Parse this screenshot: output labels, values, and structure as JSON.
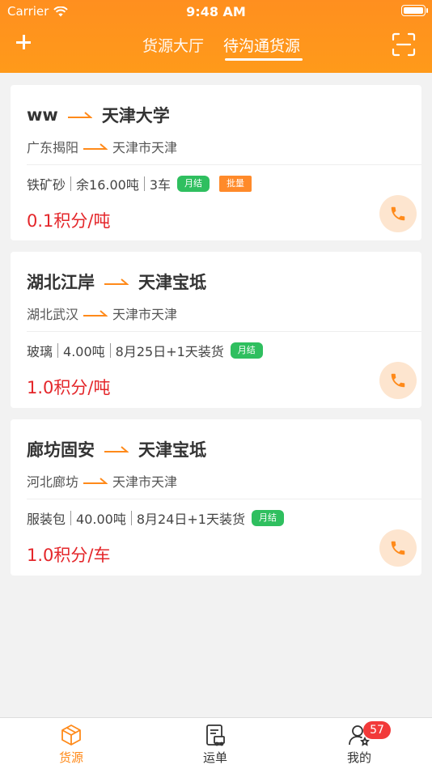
{
  "status_bar": {
    "carrier": "Carrier",
    "time": "9:48 AM"
  },
  "nav": {
    "tabs": [
      {
        "label": "货源大厅",
        "active": false
      },
      {
        "label": "待沟通货源",
        "active": true
      }
    ]
  },
  "cards": [
    {
      "from": "ww",
      "to": "天津大学",
      "sub_from": "广东揭阳",
      "sub_to": "天津市天津",
      "cargo": "铁矿砂",
      "amount": "余16.00吨",
      "extra": "3车",
      "tags": [
        "月结",
        "批量"
      ],
      "price": "0.1积分/吨"
    },
    {
      "from": "湖北江岸",
      "to": "天津宝坻",
      "sub_from": "湖北武汉",
      "sub_to": "天津市天津",
      "cargo": "玻璃",
      "amount": "4.00吨",
      "extra": "8月25日+1天装货",
      "tags": [
        "月结"
      ],
      "price": "1.0积分/吨"
    },
    {
      "from": "廊坊固安",
      "to": "天津宝坻",
      "sub_from": "河北廊坊",
      "sub_to": "天津市天津",
      "cargo": "服装包",
      "amount": "40.00吨",
      "extra": "8月24日+1天装货",
      "tags": [
        "月结"
      ],
      "price": "1.0积分/车"
    }
  ],
  "tabbar": {
    "items": [
      {
        "label": "货源",
        "icon": "box-icon",
        "active": true
      },
      {
        "label": "运单",
        "icon": "waybill-icon",
        "active": false
      },
      {
        "label": "我的",
        "icon": "user-icon",
        "active": false,
        "badge": "57"
      }
    ]
  },
  "colors": {
    "accent": "#ff8f1f",
    "price": "#e4262a",
    "tag_green": "#2fbf5f",
    "tag_orange": "#ff8a2a"
  }
}
